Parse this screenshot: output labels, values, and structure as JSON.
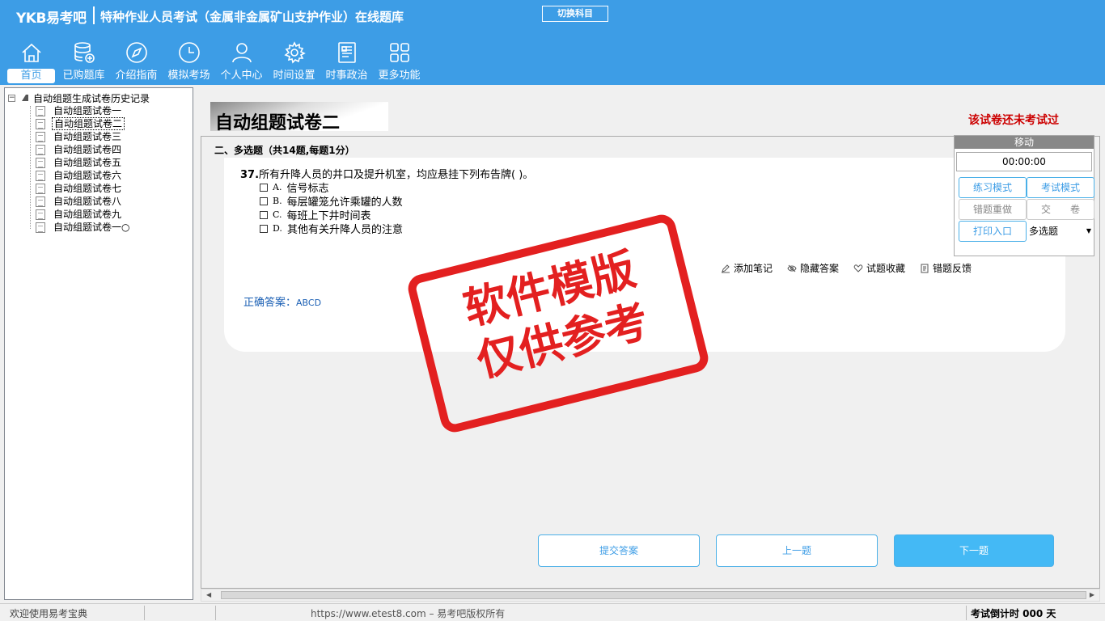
{
  "header": {
    "logo": "YKB易考吧",
    "title": "特种作业人员考试（金属非金属矿山支护作业）在线题库",
    "switch_label": "切换科目",
    "nav": [
      {
        "label": "首页",
        "icon": "home-icon"
      },
      {
        "label": "已购题库",
        "icon": "database-icon"
      },
      {
        "label": "介绍指南",
        "icon": "compass-icon"
      },
      {
        "label": "模拟考场",
        "icon": "clock-icon"
      },
      {
        "label": "个人中心",
        "icon": "user-icon"
      },
      {
        "label": "时间设置",
        "icon": "gear-icon"
      },
      {
        "label": "时事政治",
        "icon": "news-icon"
      },
      {
        "label": "更多功能",
        "icon": "grid-icon"
      }
    ]
  },
  "tree": {
    "root": "自动组题生成试卷历史记录",
    "items": [
      "自动组题试卷一",
      "自动组题试卷二",
      "自动组题试卷三",
      "自动组题试卷四",
      "自动组题试卷五",
      "自动组题试卷六",
      "自动组题试卷七",
      "自动组题试卷八",
      "自动组题试卷九",
      "自动组题试卷一○"
    ]
  },
  "paper": {
    "title": "自动组题试卷二",
    "status": "该试卷还未考试过",
    "section": "二、多选题（共14题,每题1分）"
  },
  "question": {
    "number": "37.",
    "text": "所有升降人员的井口及提升机室，均应悬挂下列布告牌( )。",
    "options": [
      {
        "letter": "A.",
        "text": "信号标志"
      },
      {
        "letter": "B.",
        "text": "每层罐笼允许乘罐的人数"
      },
      {
        "letter": "C.",
        "text": "每班上下井时间表"
      },
      {
        "letter": "D.",
        "text": "其他有关升降人员的注意"
      }
    ],
    "actions": [
      "添加笔记",
      "隐藏答案",
      "试题收藏",
      "错题反馈"
    ],
    "answer_label": "正确答案：",
    "answer_value": "ABCD"
  },
  "nav_buttons": {
    "submit": "提交答案",
    "prev": "上一题",
    "next": "下一题"
  },
  "panel": {
    "head": "移动",
    "timer": "00:00:00",
    "practice": "练习模式",
    "exam": "考试模式",
    "redo": "错题重做",
    "submit_paper": "交　　卷",
    "print": "打印入口",
    "type_select": "多选题"
  },
  "watermark": {
    "line1": "软件模版",
    "line2": "仅供参考"
  },
  "statusbar": {
    "welcome": "欢迎使用易考宝典",
    "copyright": "https://www.etest8.com – 易考吧版权所有",
    "countdown": "考试倒计时 000 天"
  },
  "colors": {
    "brand": "#3d9de6",
    "stamp": "#e32020",
    "warning": "#cc0000"
  }
}
